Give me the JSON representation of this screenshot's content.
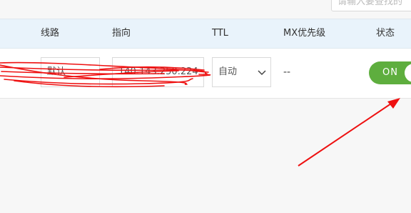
{
  "search": {
    "placeholder": "请输入要查找的"
  },
  "table": {
    "headers": {
      "line": "线路",
      "target": "指向",
      "ttl": "TTL",
      "mx": "MX优先级",
      "status": "状态"
    },
    "row": {
      "line_value": "默认",
      "target_value": "140.143.250.224",
      "ttl_value": "自动",
      "mx_value": "--",
      "status_label": "ON"
    }
  },
  "icons": {
    "select_arrow": "chevron-down-icon"
  },
  "colors": {
    "toggle_on": "#5eae3e",
    "annotation": "#ee1111",
    "header_bg": "#e9f3fb"
  }
}
